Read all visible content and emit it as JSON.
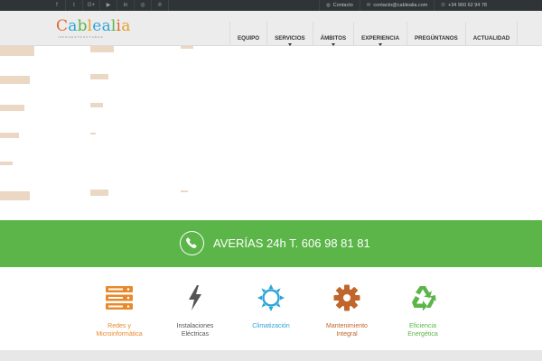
{
  "topbar": {
    "social_icons": [
      {
        "name": "facebook-icon",
        "glyph": "f"
      },
      {
        "name": "twitter-icon",
        "glyph": "t"
      },
      {
        "name": "google-plus-icon",
        "glyph": "G+"
      },
      {
        "name": "youtube-icon",
        "glyph": "▶"
      },
      {
        "name": "linkedin-icon",
        "glyph": "in"
      },
      {
        "name": "instagram-icon",
        "glyph": "◎"
      },
      {
        "name": "pinterest-icon",
        "glyph": "℗"
      }
    ],
    "contact_label": "Contacto",
    "email": "contacto@cablealia.com",
    "phone": "+34 960 62 94 78"
  },
  "header": {
    "logo": {
      "word": "Cablealia",
      "letters": [
        {
          "ch": "C",
          "color": "#e0672a"
        },
        {
          "ch": "a",
          "color": "#2ba5d8"
        },
        {
          "ch": "b",
          "color": "#5bb548"
        },
        {
          "ch": "l",
          "color": "#e8a02b"
        },
        {
          "ch": "e",
          "color": "#2ba5d8"
        },
        {
          "ch": "a",
          "color": "#2ba5d8"
        },
        {
          "ch": "l",
          "color": "#5bb548"
        },
        {
          "ch": "i",
          "color": "#e0672a"
        },
        {
          "ch": "a",
          "color": "#e8a02b"
        }
      ],
      "tagline": "INFRAESTRUCTURAS"
    },
    "nav": [
      {
        "label": "EQUIPO",
        "dropdown": false
      },
      {
        "label": "SERVICIOS",
        "dropdown": true
      },
      {
        "label": "ÁMBITOS",
        "dropdown": true
      },
      {
        "label": "EXPERIENCIA",
        "dropdown": true
      },
      {
        "label": "PREGÚNTANOS",
        "dropdown": false
      },
      {
        "label": "ACTUALIDAD",
        "dropdown": false
      }
    ]
  },
  "banner": {
    "text": "AVERÍAS 24h T. 606 98 81 81",
    "background": "#5bb548"
  },
  "services": [
    {
      "label_line1": "Redes y",
      "label_line2": "Microinformática",
      "color": "#e8892b",
      "icon": "server-icon"
    },
    {
      "label_line1": "Instalaciones",
      "label_line2": "Eléctricas",
      "color": "#555555",
      "icon": "lightning-icon"
    },
    {
      "label_line1": "Climatización",
      "label_line2": "",
      "color": "#2ba5d8",
      "icon": "sun-icon"
    },
    {
      "label_line1": "Mantenimiento",
      "label_line2": "Integral",
      "color": "#c0652b",
      "icon": "gear-icon"
    },
    {
      "label_line1": "Eficiencia",
      "label_line2": "Energética",
      "color": "#5bb548",
      "icon": "recycle-icon"
    }
  ]
}
